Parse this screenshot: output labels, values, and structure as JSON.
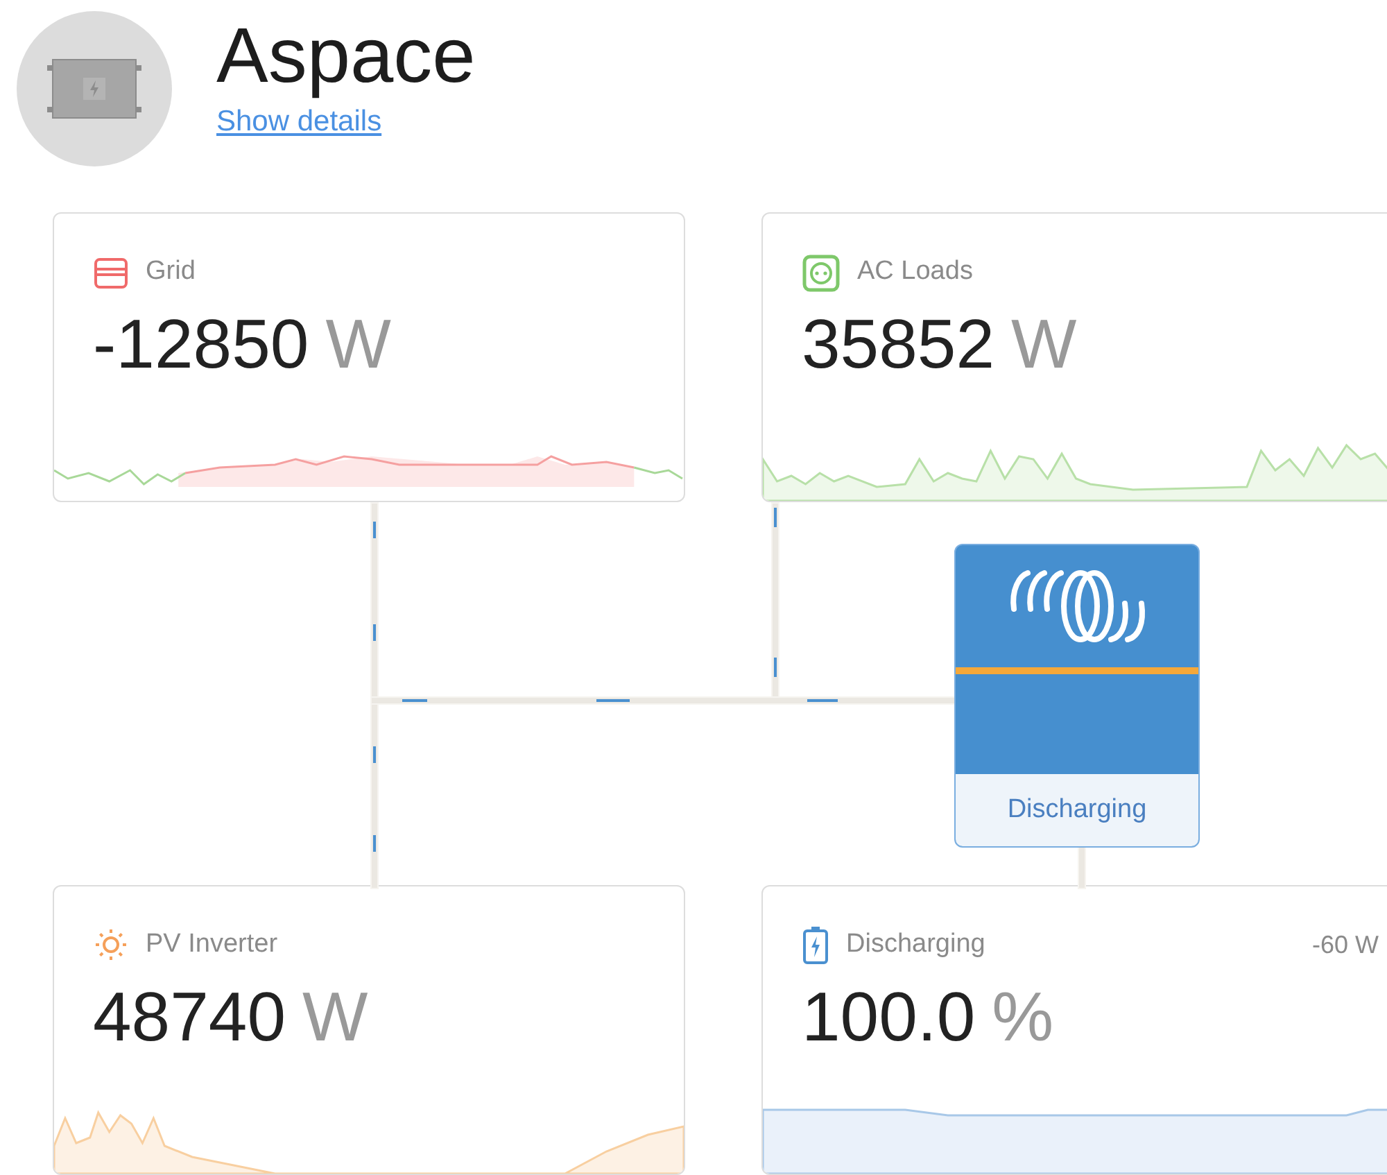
{
  "device": {
    "name": "Aspace",
    "details_link": "Show details"
  },
  "top_cards": [
    {
      "kind": "grid",
      "label": "Grid",
      "value": "-12850",
      "unit": "W"
    },
    {
      "kind": "ac_loads",
      "label": "AC Loads",
      "value": "35852",
      "unit": "W"
    }
  ],
  "inverter": {
    "status": "Discharging"
  },
  "bottom_cards": [
    {
      "kind": "pv",
      "label": "PV Inverter",
      "value": "48740",
      "unit": "W"
    },
    {
      "kind": "battery",
      "label": "Discharging",
      "value": "100.0",
      "unit": "%",
      "side_reading": "-60 W"
    }
  ]
}
